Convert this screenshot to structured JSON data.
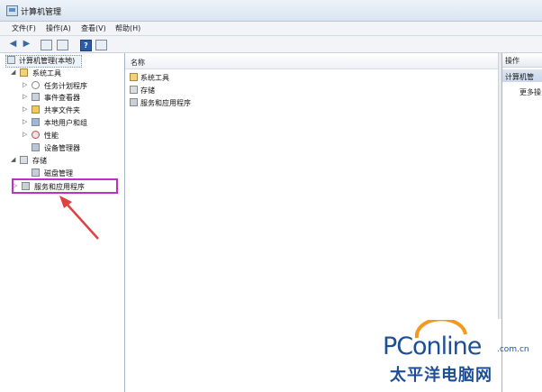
{
  "window": {
    "title": "计算机管理"
  },
  "menu": [
    "文件(F)",
    "操作(A)",
    "查看(V)",
    "帮助(H)"
  ],
  "toolbar": {
    "help_glyph": "?"
  },
  "tree": {
    "root": "计算机管理(本地)",
    "system_tools": "系统工具",
    "task_scheduler": "任务计划程序",
    "event_viewer": "事件查看器",
    "shared_folders": "共享文件夹",
    "local_users": "本地用户和组",
    "performance": "性能",
    "device_manager": "设备管理器",
    "storage": "存储",
    "disk_management": "磁盘管理",
    "services_apps": "服务和应用程序"
  },
  "center": {
    "column_header": "名称",
    "items": [
      "系统工具",
      "存储",
      "服务和应用程序"
    ]
  },
  "actions": {
    "header": "操作",
    "section": "计算机管",
    "more": "更多操"
  },
  "watermark": {
    "brand_p": "PC",
    "brand_online": "online",
    "brand_domain": ".com.cn",
    "brand_cn": "太平洋电脑网"
  },
  "colors": {
    "highlight": "#c030c8",
    "arrow": "#e04040",
    "brand": "#1d4f96",
    "brand_accent": "#f29a1d"
  }
}
